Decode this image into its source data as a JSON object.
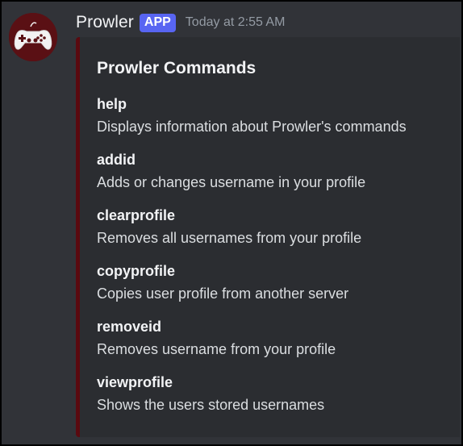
{
  "message": {
    "author": "Prowler",
    "badge": "APP",
    "timestamp": "Today at 2:55 AM",
    "avatar_icon": "gamepad-icon"
  },
  "embed": {
    "accent_color": "#5a0a10",
    "title": "Prowler Commands",
    "fields": [
      {
        "name": "help",
        "value": "Displays information about Prowler's commands"
      },
      {
        "name": "addid",
        "value": "Adds or changes username in your profile"
      },
      {
        "name": "clearprofile",
        "value": "Removes all usernames from your profile"
      },
      {
        "name": "copyprofile",
        "value": "Copies user profile from another server"
      },
      {
        "name": "removeid",
        "value": "Removes username from your profile"
      },
      {
        "name": "viewprofile",
        "value": "Shows the users stored usernames"
      }
    ]
  },
  "colors": {
    "background": "#313338",
    "embed_background": "#2b2d31",
    "badge": "#5865f2",
    "timestamp": "#949ba4"
  }
}
